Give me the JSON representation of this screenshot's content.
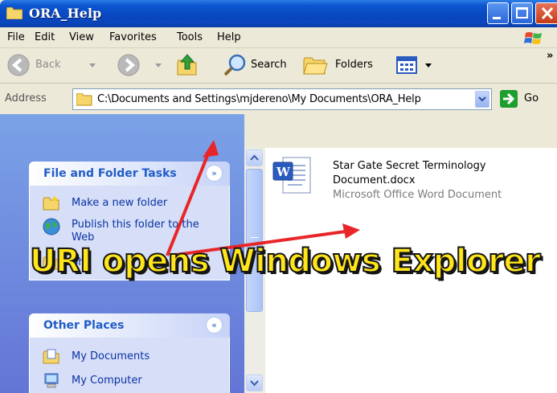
{
  "window": {
    "title": "ORA_Help"
  },
  "menu": {
    "items": [
      "File",
      "Edit",
      "View",
      "Favorites",
      "Tools",
      "Help"
    ]
  },
  "toolbar": {
    "back_label": "Back",
    "search_label": "Search",
    "folders_label": "Folders",
    "overflow": "»"
  },
  "address": {
    "label": "Address",
    "path": "C:\\Documents and Settings\\mjdereno\\My Documents\\ORA_Help",
    "go_label": "Go"
  },
  "panels": {
    "file_tasks": {
      "title": "File and Folder Tasks",
      "toggle": "»",
      "items": [
        {
          "label": "Make a new folder",
          "icon": "folder-new-icon"
        },
        {
          "label": "Publish this folder to the Web",
          "icon": "globe-publish-icon"
        }
      ],
      "partial": "Sha"
    },
    "other_places": {
      "title": "Other Places",
      "toggle": "«",
      "items": [
        {
          "label": "My Documents",
          "icon": "my-documents-icon"
        },
        {
          "label": "My Computer",
          "icon": "my-computer-icon"
        }
      ]
    }
  },
  "file": {
    "name_line1": "Star Gate Secret Terminology",
    "name_line2": "Document.docx",
    "type": "Microsoft Office Word Document"
  },
  "annotation": {
    "text": "URI opens Windows Explorer",
    "color": "#ffe519",
    "arrow_color": "#e8262a"
  }
}
